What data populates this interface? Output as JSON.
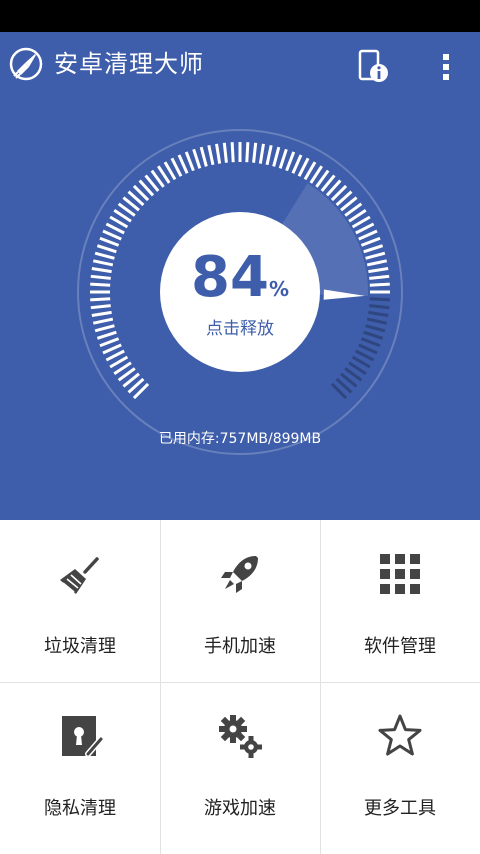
{
  "app": {
    "title": "安卓清理大师",
    "logo_icon": "broom-rocket-logo-icon",
    "actions": [
      {
        "name": "device-info-icon"
      },
      {
        "name": "overflow-menu-icon"
      }
    ]
  },
  "gauge": {
    "percent": "84",
    "percent_unit": "%",
    "used_fraction": 0.84,
    "action_label": "点击释放",
    "memory_text": "已用内存:757MB/899MB"
  },
  "tools": [
    {
      "label": "垃圾清理",
      "icon": "broom-icon"
    },
    {
      "label": "手机加速",
      "icon": "rocket-icon"
    },
    {
      "label": "软件管理",
      "icon": "grid-apps-icon"
    },
    {
      "label": "隐私清理",
      "icon": "privacy-lock-icon"
    },
    {
      "label": "游戏加速",
      "icon": "gears-icon"
    },
    {
      "label": "更多工具",
      "icon": "star-icon"
    }
  ],
  "colors": {
    "primary": "#3e5daa",
    "white": "#ffffff",
    "icon_gray": "#444444",
    "divider": "#e2e2e2"
  }
}
